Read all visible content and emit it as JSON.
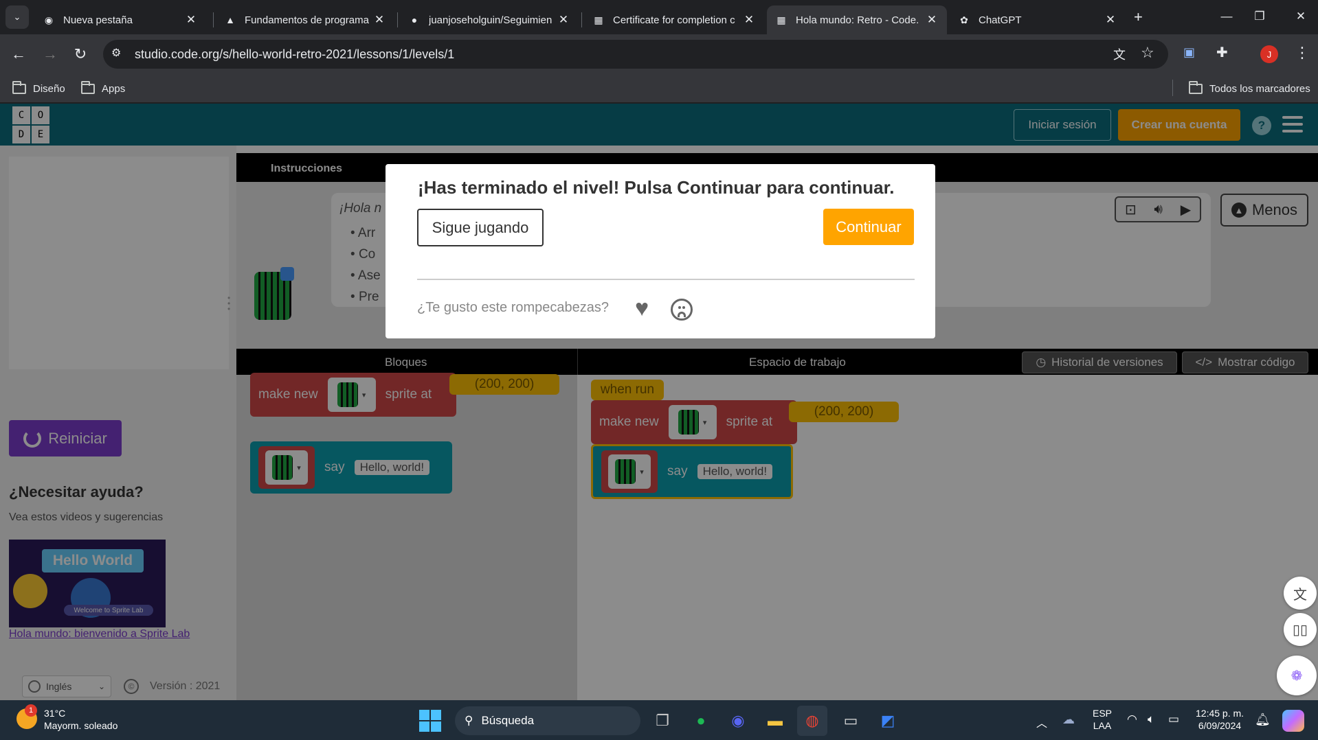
{
  "browser": {
    "tabs": [
      {
        "title": "Nueva pestaña",
        "icon": "chrome-icon",
        "active": false
      },
      {
        "title": "Fundamentos de programa",
        "icon": "course-icon",
        "active": false
      },
      {
        "title": "juanjoseholguin/Seguimien",
        "icon": "github-icon",
        "active": false
      },
      {
        "title": "Certificate for completion c",
        "icon": "codeorg-icon",
        "active": false
      },
      {
        "title": "Hola mundo: Retro - Code.",
        "icon": "codeorg-icon",
        "active": true
      },
      {
        "title": "ChatGPT",
        "icon": "chatgpt-icon",
        "active": false
      }
    ],
    "url": "studio.code.org/s/hello-world-retro-2021/lessons/1/levels/1",
    "bookmarks": [
      "Diseño",
      "Apps"
    ],
    "all_bookmarks": "Todos los marcadores",
    "profile_initial": "J"
  },
  "site": {
    "logo_letters": [
      "C",
      "O",
      "D",
      "E"
    ],
    "signin": "Iniciar sesión",
    "signup": "Crear una cuenta",
    "help": "?"
  },
  "left": {
    "reset": "Reiniciar",
    "help_heading": "¿Necesitar ayuda?",
    "help_sub": "Vea estos videos y sugerencias",
    "video_title": "Hello World",
    "video_subtitle": "Welcome to Sprite Lab",
    "video_link": "Hola mundo: bienvenido a Sprite Lab",
    "language": "Inglés",
    "version": "Versión : 2021"
  },
  "instructions": {
    "tab": "Instrucciones",
    "greeting": "¡Hola n",
    "bullets": [
      "Arr",
      "Co",
      "Ase",
      "Pre"
    ],
    "menos": "Menos"
  },
  "toolbox": {
    "header": "Bloques",
    "workspace_header": "Espacio de trabajo",
    "version_history": "Historial de versiones",
    "show_code": "Mostrar código",
    "make_new": "make new",
    "sprite_at": "sprite at",
    "coords": "(200, 200)",
    "say": "say",
    "hello": "Hello, world!",
    "when_run": "when run"
  },
  "modal": {
    "message": "¡Has terminado el nivel! Pulsa Continuar para continuar.",
    "keep_playing": "Sigue jugando",
    "continue": "Continuar",
    "rate_question": "¿Te gusto este rompecabezas?"
  },
  "taskbar": {
    "weather_temp": "31°C",
    "weather_desc": "Mayorm. soleado",
    "weather_badge": "1",
    "search": "Búsqueda",
    "lang_top": "ESP",
    "lang_bottom": "LAA",
    "time": "12:45 p. m.",
    "date": "6/09/2024"
  },
  "colors": {
    "header_teal": "#0b6e7e",
    "accent_orange": "#ffa400",
    "reset_purple": "#7d3dce"
  }
}
